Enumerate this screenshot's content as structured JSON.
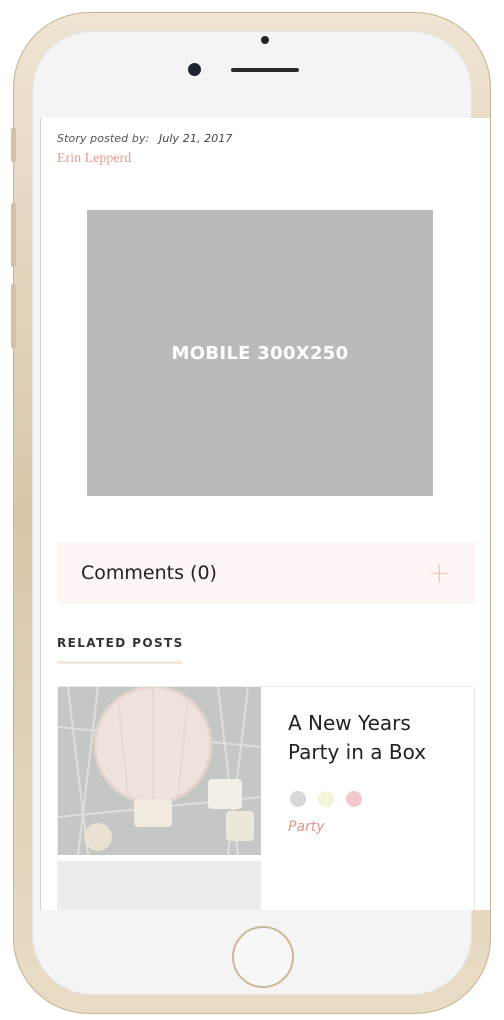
{
  "byline": {
    "prefix": "Story posted by:",
    "date": "July 21, 2017",
    "author": "Erin Lepperd"
  },
  "ad": {
    "label": "MOBILE 300X250"
  },
  "comments": {
    "label": "Comments (0)",
    "toggle_icon": "+"
  },
  "related": {
    "heading": "RELATED POSTS",
    "posts": [
      {
        "title": "A New Years Party in a Box",
        "category": "Party",
        "swatches": [
          "#d7d7d7",
          "#f5f3d8",
          "#f4c6d0"
        ]
      }
    ]
  },
  "colors": {
    "accent": "#e79a8e",
    "ad_background": "#b9babb",
    "comments_background": "#fdf6f5",
    "phone_frame": "#e3d4bb"
  }
}
